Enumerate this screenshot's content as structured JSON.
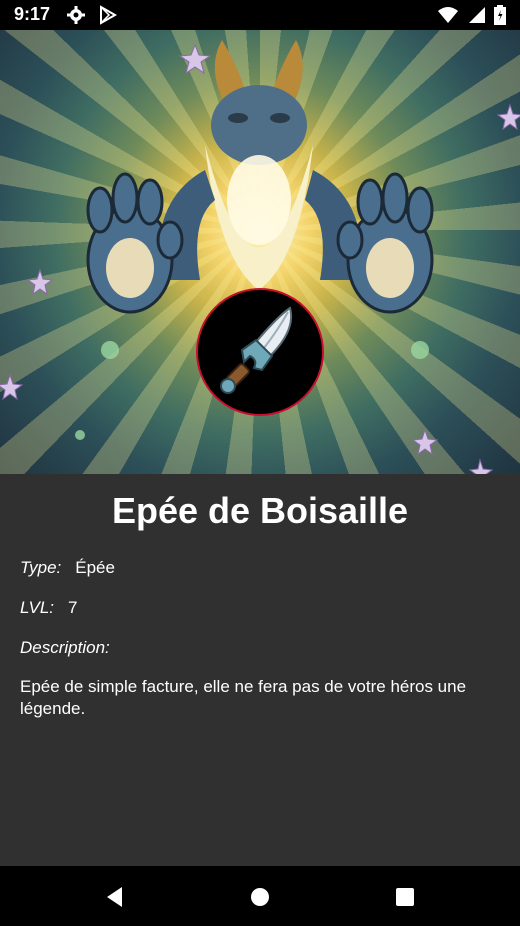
{
  "status_bar": {
    "time": "9:17",
    "left_icons": [
      "gear-icon",
      "play-store-icon"
    ],
    "right_icons": [
      "wifi-icon",
      "signal-icon",
      "battery-icon"
    ]
  },
  "item": {
    "name": "Epée de Boisaille",
    "type_label": "Type:",
    "type_value": "Épée",
    "lvl_label": "LVL:",
    "lvl_value": "7",
    "description_label": "Description:",
    "description_text": "Epée de simple facture, elle ne fera pas de votre héros une légende."
  },
  "colors": {
    "background": "#303030",
    "badge_border": "#c8102e",
    "bars": "#000000"
  },
  "nav_bar": {
    "buttons": [
      "back-icon",
      "home-icon",
      "recents-icon"
    ]
  }
}
